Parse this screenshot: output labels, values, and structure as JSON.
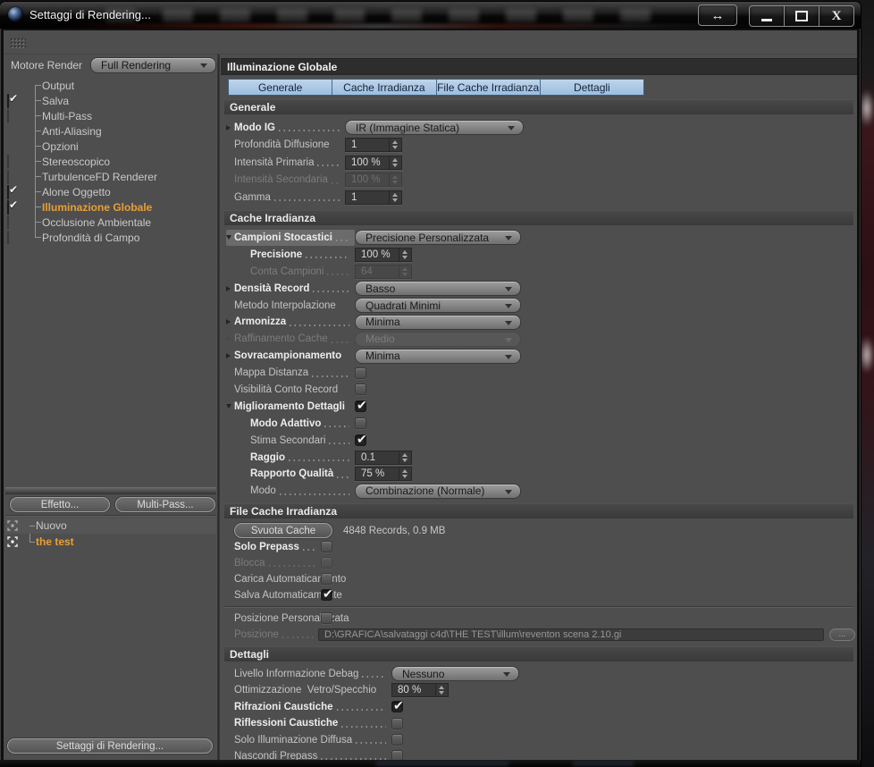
{
  "colors": {
    "accent_orange": "#e89f35",
    "tab_blue": "#aac7e3",
    "panel_bg": "#4e4e4e",
    "section_header_bg": "#3d3d3d",
    "selection_bg": "#6b6b6b",
    "control_face": "#8d8d8d",
    "field_bg": "#383838"
  },
  "window": {
    "title": "Settaggi di Rendering...",
    "controls": {
      "swap": "↔",
      "minimize": "—",
      "maximize": "□",
      "close": "X"
    }
  },
  "sidebar": {
    "engine_label": "Motore Render",
    "engine_value": "Full Rendering",
    "tree": [
      {
        "label": "Output",
        "check": "none"
      },
      {
        "label": "Salva",
        "check": "on"
      },
      {
        "label": "Multi-Pass",
        "check": "off"
      },
      {
        "label": "Anti-Aliasing",
        "check": "none"
      },
      {
        "label": "Opzioni",
        "check": "none"
      },
      {
        "label": "Stereoscopico",
        "check": "off"
      },
      {
        "label": "TurbulenceFD Renderer",
        "check": "off"
      },
      {
        "label": "Alone Oggetto",
        "check": "on"
      },
      {
        "label": "Illuminazione Globale",
        "check": "on",
        "active": true
      },
      {
        "label": "Occlusione Ambientale",
        "check": "off"
      },
      {
        "label": "Profondità di Campo",
        "check": "off"
      }
    ],
    "effect_button": "Effetto...",
    "multipass_button": "Multi-Pass...",
    "presets": [
      {
        "label": "Nuovo",
        "active": false
      },
      {
        "label": "the test",
        "active": true
      }
    ],
    "settings_button": "Settaggi di Rendering..."
  },
  "main": {
    "header": "Illuminazione Globale",
    "tabs": [
      "Generale",
      "Cache Irradianza",
      "File Cache Irradianza",
      "Dettagli"
    ],
    "sections": [
      {
        "id": "generale",
        "title": "Generale",
        "rows": [
          {
            "label": "Modo IG",
            "bold": true,
            "expander": "collapsed",
            "leader": true,
            "control": {
              "type": "dropdown",
              "value": "IR (Immagine Statica)"
            }
          },
          {
            "label": "Profondità Diffusione",
            "leader": false,
            "control": {
              "type": "spinner",
              "value": "1"
            }
          },
          {
            "label": "Intensità Primaria",
            "leader": true,
            "control": {
              "type": "spinner",
              "value": "100 %"
            }
          },
          {
            "label": "Intensità Secondaria",
            "disabled": true,
            "leader": false,
            "control": {
              "type": "spinner",
              "value": "100 %",
              "disabled": true
            }
          },
          {
            "label": "Gamma",
            "leader": true,
            "control": {
              "type": "spinner",
              "value": "1"
            }
          }
        ]
      },
      {
        "id": "cache",
        "title": "Cache Irradianza",
        "rows": [
          {
            "label": "Campioni Stocastici",
            "bold": true,
            "expander": "expanded",
            "selected": true,
            "leader": true,
            "control": {
              "type": "dropdown",
              "value": "Precisione Personalizzata"
            }
          },
          {
            "label": "Precisione",
            "bold": true,
            "indent": 1,
            "leader": true,
            "control": {
              "type": "spinner",
              "value": "100 %"
            }
          },
          {
            "label": "Conta Campioni",
            "disabled": true,
            "indent": 1,
            "leader": true,
            "control": {
              "type": "spinner",
              "value": "64",
              "disabled": true
            }
          },
          {
            "label": "Densità Record",
            "bold": true,
            "expander": "collapsed",
            "leader": true,
            "control": {
              "type": "dropdown",
              "value": "Basso"
            }
          },
          {
            "label": "Metodo Interpolazione",
            "leader": false,
            "control": {
              "type": "dropdown",
              "value": "Quadrati Minimi"
            }
          },
          {
            "label": "Armonizza",
            "bold": true,
            "expander": "collapsed",
            "leader": true,
            "control": {
              "type": "dropdown",
              "value": "Minima"
            }
          },
          {
            "label": "Raffinamento Cache",
            "disabled": true,
            "expander": "collapsed",
            "leader": true,
            "control": {
              "type": "dropdown",
              "value": "Medio",
              "disabled": true
            }
          },
          {
            "label": "Sovracampionamento",
            "bold": true,
            "expander": "collapsed",
            "leader": false,
            "control": {
              "type": "dropdown",
              "value": "Minima"
            }
          },
          {
            "label": "Mappa Distanza",
            "leader": true,
            "control": {
              "type": "checkbox",
              "checked": false
            }
          },
          {
            "label": "Visibilità Conto Record",
            "leader": false,
            "control": {
              "type": "checkbox",
              "checked": false
            }
          },
          {
            "label": "Miglioramento Dettagli",
            "bold": true,
            "expander": "expanded",
            "leader": false,
            "control": {
              "type": "checkbox",
              "checked": true
            }
          },
          {
            "label": "Modo Adattivo",
            "bold": true,
            "indent": 1,
            "leader": true,
            "control": {
              "type": "checkbox",
              "checked": false
            }
          },
          {
            "label": "Stima Secondari",
            "indent": 1,
            "leader": true,
            "control": {
              "type": "checkbox",
              "checked": true
            }
          },
          {
            "label": "Raggio",
            "bold": true,
            "indent": 1,
            "leader": true,
            "control": {
              "type": "spinner",
              "value": "0.1"
            }
          },
          {
            "label": "Rapporto Qualità",
            "bold": true,
            "indent": 1,
            "leader": true,
            "control": {
              "type": "spinner",
              "value": "75 %"
            }
          },
          {
            "label": "Modo",
            "indent": 1,
            "leader": true,
            "control": {
              "type": "dropdown",
              "value": "Combinazione (Normale)"
            }
          }
        ]
      },
      {
        "id": "file",
        "title": "File Cache Irradianza",
        "rows": [
          {
            "type": "buttons",
            "button": "Svuota Cache",
            "info": "4848 Records, 0.9 MB"
          },
          {
            "label": "Solo Prepass",
            "bold": true,
            "leader": true,
            "control": {
              "type": "checkbox",
              "checked": false
            }
          },
          {
            "label": "Blocca",
            "disabled": true,
            "leader": true,
            "control": {
              "type": "checkbox",
              "checked": false,
              "disabled": true
            }
          },
          {
            "label": "Carica Automaticamento",
            "leader": false,
            "control": {
              "type": "checkbox",
              "checked": false
            }
          },
          {
            "label": "Salva Automaticamente",
            "leader": false,
            "control": {
              "type": "checkbox",
              "checked": true
            }
          },
          {
            "type": "separator"
          },
          {
            "label": "Posizione Personalizzata",
            "leader": false,
            "control": {
              "type": "checkbox",
              "checked": false
            }
          },
          {
            "label": "Posizione",
            "disabled": true,
            "leader": true,
            "control": {
              "type": "path",
              "value": "D:\\GRAFICA\\salvataggi c4d\\THE TEST\\illum\\reventon scena 2.10.gi",
              "browse": "...",
              "disabled": true
            }
          }
        ]
      },
      {
        "id": "dettagli",
        "title": "Dettagli",
        "rows": [
          {
            "label": "Livello Informazione Debag",
            "leader": true,
            "control": {
              "type": "dropdown",
              "value": "Nessuno"
            }
          },
          {
            "label": "Ottimizzazione  Vetro/Specchio",
            "leader": false,
            "control": {
              "type": "spinner",
              "value": "80 %"
            }
          },
          {
            "label": "Rifrazioni Caustiche",
            "bold": true,
            "leader": true,
            "control": {
              "type": "checkbox",
              "checked": true
            }
          },
          {
            "label": "Riflessioni Caustiche",
            "bold": true,
            "leader": true,
            "control": {
              "type": "checkbox",
              "checked": false
            }
          },
          {
            "label": "Solo Illuminazione Diffusa",
            "leader": true,
            "control": {
              "type": "checkbox",
              "checked": false
            }
          },
          {
            "label": "Nascondi Prepass",
            "leader": true,
            "control": {
              "type": "checkbox",
              "checked": false
            }
          }
        ]
      }
    ]
  }
}
